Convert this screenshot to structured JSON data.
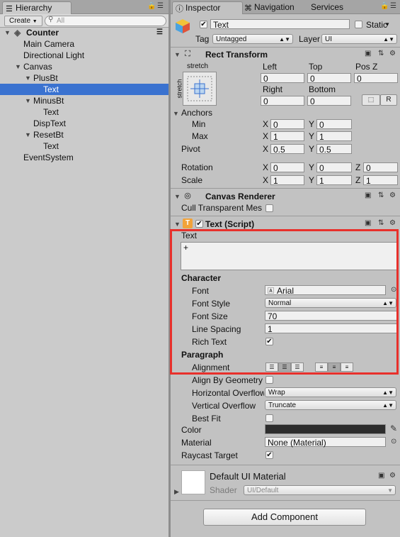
{
  "hierarchy": {
    "tab_label": "Hierarchy",
    "create_label": "Create",
    "search_placeholder": "All",
    "scene_name": "Counter",
    "items": [
      {
        "label": "Main Camera"
      },
      {
        "label": "Directional Light"
      },
      {
        "label": "Canvas"
      },
      {
        "label": "PlusBt"
      },
      {
        "label": "Text"
      },
      {
        "label": "MinusBt"
      },
      {
        "label": "Text"
      },
      {
        "label": "DispText"
      },
      {
        "label": "ResetBt"
      },
      {
        "label": "Text"
      },
      {
        "label": "EventSystem"
      }
    ]
  },
  "inspector": {
    "tabs": {
      "inspector": "Inspector",
      "navigation": "Navigation",
      "services": "Services"
    },
    "object": {
      "name": "Text",
      "static_label": "Static",
      "tag_label": "Tag",
      "tag_value": "Untagged",
      "layer_label": "Layer",
      "layer_value": "UI"
    },
    "rect_transform": {
      "title": "Rect Transform",
      "anchor_preset": "stretch",
      "anchor_preset_side": "stretch",
      "col_left": "Left",
      "col_top": "Top",
      "col_posz": "Pos Z",
      "left": "0",
      "top": "0",
      "posz": "0",
      "col_right": "Right",
      "col_bottom": "Bottom",
      "right": "0",
      "bottom": "0",
      "r_button": "R",
      "anchors_label": "Anchors",
      "min_label": "Min",
      "min_x": "0",
      "min_y": "0",
      "max_label": "Max",
      "max_x": "1",
      "max_y": "1",
      "pivot_label": "Pivot",
      "pivot_x": "0.5",
      "pivot_y": "0.5",
      "rotation_label": "Rotation",
      "rot_x": "0",
      "rot_y": "0",
      "rot_z": "0",
      "scale_label": "Scale",
      "scale_x": "1",
      "scale_y": "1",
      "scale_z": "1",
      "x": "X",
      "y": "Y",
      "z": "Z"
    },
    "canvas_renderer": {
      "title": "Canvas Renderer",
      "cull_label": "Cull Transparent Mesh"
    },
    "text_script": {
      "title": "Text (Script)",
      "text_label": "Text",
      "text_value": "+",
      "character_header": "Character",
      "font_label": "Font",
      "font_value": "Arial",
      "font_style_label": "Font Style",
      "font_style_value": "Normal",
      "font_size_label": "Font Size",
      "font_size_value": "70",
      "line_spacing_label": "Line Spacing",
      "line_spacing_value": "1",
      "rich_text_label": "Rich Text",
      "paragraph_header": "Paragraph",
      "alignment_label": "Alignment",
      "align_geom_label": "Align By Geometry",
      "h_overflow_label": "Horizontal Overflow",
      "h_overflow_value": "Wrap",
      "v_overflow_label": "Vertical Overflow",
      "v_overflow_value": "Truncate",
      "best_fit_label": "Best Fit",
      "color_label": "Color",
      "color_value": "#2d2d2d",
      "material_label": "Material",
      "material_value": "None (Material)",
      "raycast_label": "Raycast Target"
    },
    "material_preview": {
      "name": "Default UI Material",
      "shader_label": "Shader",
      "shader_value": "UI/Default"
    },
    "add_component_label": "Add Component"
  }
}
